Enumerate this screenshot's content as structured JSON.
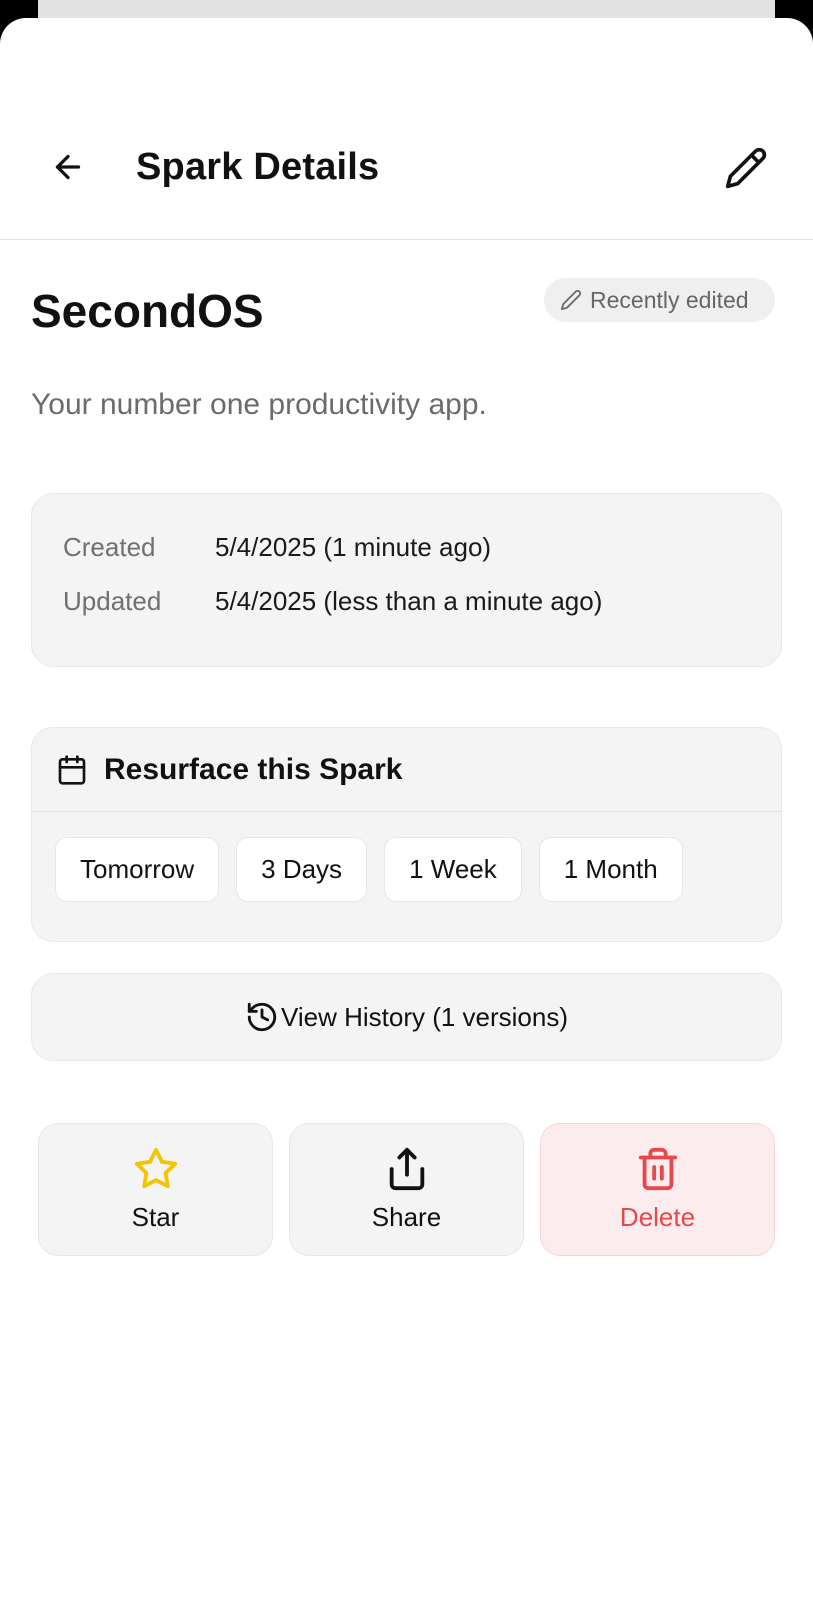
{
  "header": {
    "title": "Spark Details"
  },
  "spark": {
    "title": "SecondOS",
    "badge": "Recently edited",
    "description": "Your number one productivity app."
  },
  "meta": {
    "created_label": "Created",
    "created_value": "5/4/2025 (1 minute ago)",
    "updated_label": "Updated",
    "updated_value": "5/4/2025 (less than a minute ago)"
  },
  "resurface": {
    "title": "Resurface this Spark",
    "options": [
      "Tomorrow",
      "3 Days",
      "1 Week",
      "1 Month"
    ]
  },
  "history": {
    "label": "View History (1 versions)"
  },
  "actions": {
    "star": "Star",
    "share": "Share",
    "delete": "Delete"
  },
  "icons": {
    "back": "arrow-left-icon",
    "edit": "pencil-icon",
    "badge": "pencil-icon",
    "calendar": "calendar-icon",
    "history": "history-icon",
    "star": "star-icon",
    "share": "share-icon",
    "delete": "trash-icon"
  },
  "colors": {
    "star": "#f5c400",
    "delete": "#e5484d",
    "delete_bg": "#fdeced",
    "card_bg": "#f4f4f4",
    "muted_text": "#6b6b6b"
  }
}
